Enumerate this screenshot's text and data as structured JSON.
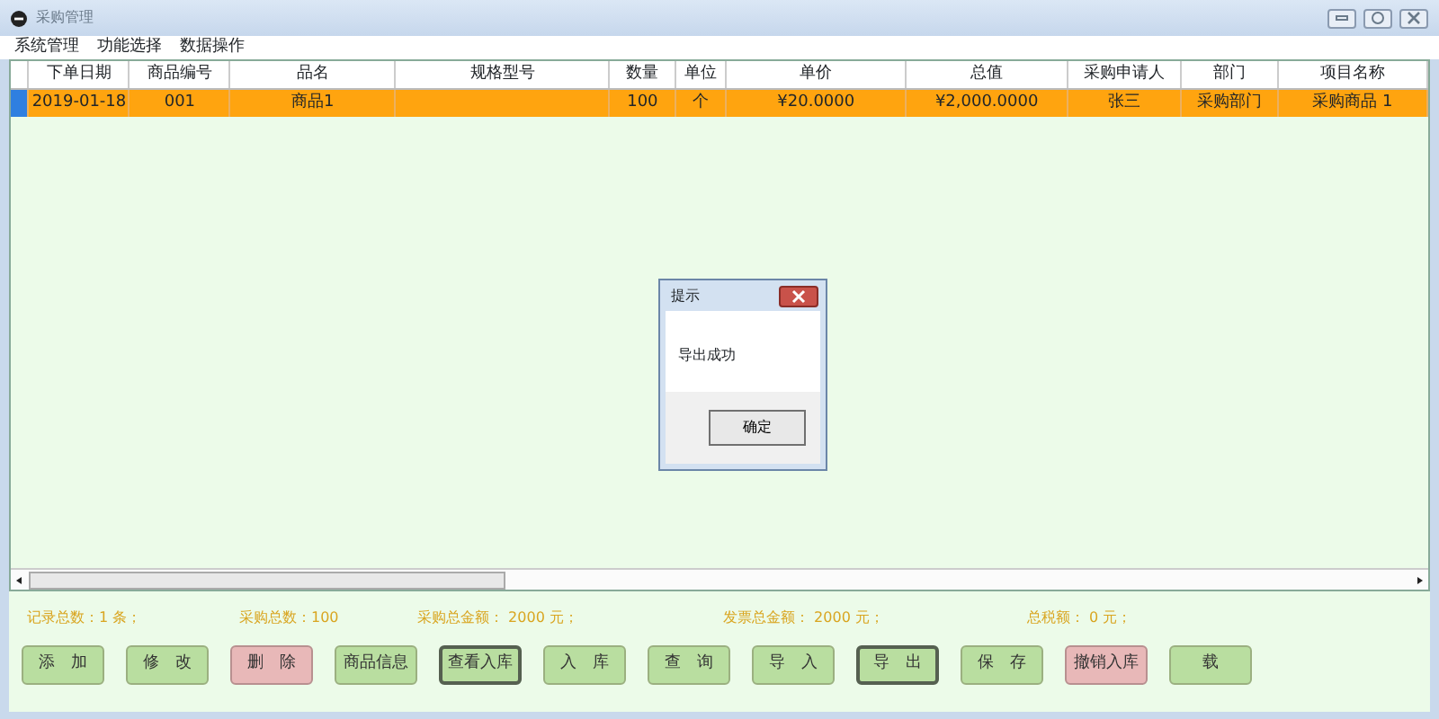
{
  "window": {
    "title": "采购管理"
  },
  "menu": [
    "系统管理",
    "功能选择",
    "数据操作"
  ],
  "table": {
    "columns": [
      "下单日期",
      "商品编号",
      "品名",
      "规格型号",
      "数量",
      "单位",
      "单价",
      "总值",
      "采购申请人",
      "部门",
      "项目名称"
    ],
    "rows": [
      {
        "selected": true,
        "cells": [
          "2019-01-18",
          "001",
          "商品1",
          "",
          "100",
          "个",
          "¥20.0000",
          "¥2,000.0000",
          "张三",
          "采购部门",
          "采购商品 1"
        ]
      }
    ]
  },
  "summary": [
    "记录总数：1 条；",
    "采购总数：100",
    "采购总金额： 2000 元；",
    "发票总金额： 2000 元；",
    "总税额： 0 元；"
  ],
  "buttons": [
    {
      "label": "添　加",
      "kind": "normal",
      "focused": false
    },
    {
      "label": "修　改",
      "kind": "normal",
      "focused": false
    },
    {
      "label": "删　除",
      "kind": "danger",
      "focused": false
    },
    {
      "label": "商品信息",
      "kind": "normal",
      "focused": false
    },
    {
      "label": "查看入库",
      "kind": "normal",
      "focused": true
    },
    {
      "label": "入　库",
      "kind": "normal",
      "focused": false
    },
    {
      "label": "查　询",
      "kind": "normal",
      "focused": false
    },
    {
      "label": "导　入",
      "kind": "normal",
      "focused": false
    },
    {
      "label": "导　出",
      "kind": "normal",
      "focused": true
    },
    {
      "label": "保　存",
      "kind": "normal",
      "focused": false
    },
    {
      "label": "撤销入库",
      "kind": "danger",
      "focused": false
    },
    {
      "label": "载",
      "kind": "normal",
      "focused": false
    }
  ],
  "dialog": {
    "title": "提示",
    "message": "导出成功",
    "button": "确定"
  }
}
